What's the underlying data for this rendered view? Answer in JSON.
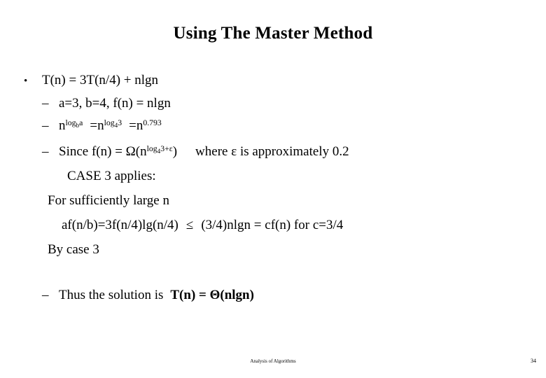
{
  "slide": {
    "title": "Using The Master Method",
    "background_color": "#ffffff",
    "text_color": "#000000"
  },
  "bullets": {
    "marker_level1": "•",
    "marker_level2": "–",
    "line1": "T(n) = 3T(n/4) + nlgn",
    "line2": "a=3,  b=4,  f(n) = nlgn",
    "line3": {
      "base1": "n",
      "sup1_log": "log",
      "sup1_sub": "b",
      "sup1_arg": "a",
      "eq1": "=",
      "base2": "n",
      "sup2_log": "log",
      "sup2_sub": "4",
      "sup2_arg": "3",
      "eq2": "=",
      "base3": "n",
      "sup3": "0.793"
    },
    "line4": {
      "prefix": "Since f(n) = Ω(n",
      "sup_log": "log",
      "sup_sub": "4",
      "sup_arg": "3+ε",
      "suffix": ")",
      "note": "where ε is approximately 0.2"
    },
    "line5": "CASE 3 applies:",
    "line6": "For sufficiently large n",
    "line7": {
      "left": "af(n/b)=3f(n/4)lg(n/4)",
      "relation": "≤",
      "right": "(3/4)nlgn = cf(n) for c=3/4"
    },
    "line8": "By case 3",
    "line9": {
      "text": "Thus the solution is",
      "bold_text": "T(n) = Θ(nlgn)"
    }
  },
  "footer": {
    "center_text": "Analysis of Algorithms",
    "page_number": "34"
  }
}
